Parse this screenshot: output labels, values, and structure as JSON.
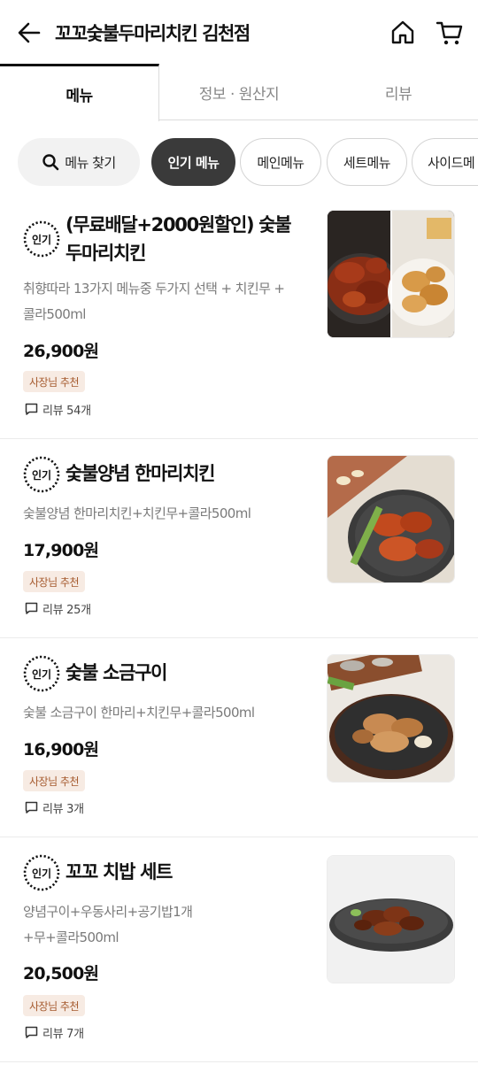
{
  "header": {
    "title": "꼬꼬숯불두마리치킨 김천점",
    "icons": {
      "back": "arrow-left-icon",
      "home": "home-icon",
      "cart": "cart-icon"
    }
  },
  "tabs": [
    {
      "label": "메뉴",
      "active": true
    },
    {
      "label": "정보 · 원산지",
      "active": false
    },
    {
      "label": "리뷰",
      "active": false
    }
  ],
  "chips": {
    "search_label": "메뉴 찾기",
    "categories": [
      "인기 메뉴",
      "메인메뉴",
      "세트메뉴",
      "사이드메"
    ],
    "active_index": 0
  },
  "badge_text": "인기",
  "items": [
    {
      "name": "(무료배달+2000원할인) 숯불두마리치킨",
      "name_line1": "(무료배달+2000원할인) 숯불",
      "name_line2": "두마리치킨",
      "desc_line1": "취향따라 13가지 메뉴중 두가지 선택 + 치킨무 +",
      "desc_line2": "콜라500ml",
      "price": "26,900원",
      "owner_badge": "사장님 추천",
      "reviews": "리뷰 54개"
    },
    {
      "name": "숯불양념 한마리치킨",
      "desc_line1": "숯불양념 한마리치킨+치킨무+콜라500ml",
      "price": "17,900원",
      "owner_badge": "사장님 추천",
      "reviews": "리뷰 25개"
    },
    {
      "name": "숯불 소금구이",
      "desc_line1": "숯불 소금구이 한마리+치킨무+콜라500ml",
      "price": "16,900원",
      "owner_badge": "사장님 추천",
      "reviews": "리뷰 3개"
    },
    {
      "name": "꼬꼬 치밥 세트",
      "desc_line1": "양념구이+우동사리+공기밥1개",
      "desc_line2": "+무+콜라500ml",
      "price": "20,500원",
      "owner_badge": "사장님 추천",
      "reviews": "리뷰 7개"
    }
  ],
  "colors": {
    "active_chip": "#3a3a3a",
    "owner_badge_bg": "#f7ebe3",
    "owner_badge_text": "#a55a2e",
    "divider": "#ebebeb"
  }
}
